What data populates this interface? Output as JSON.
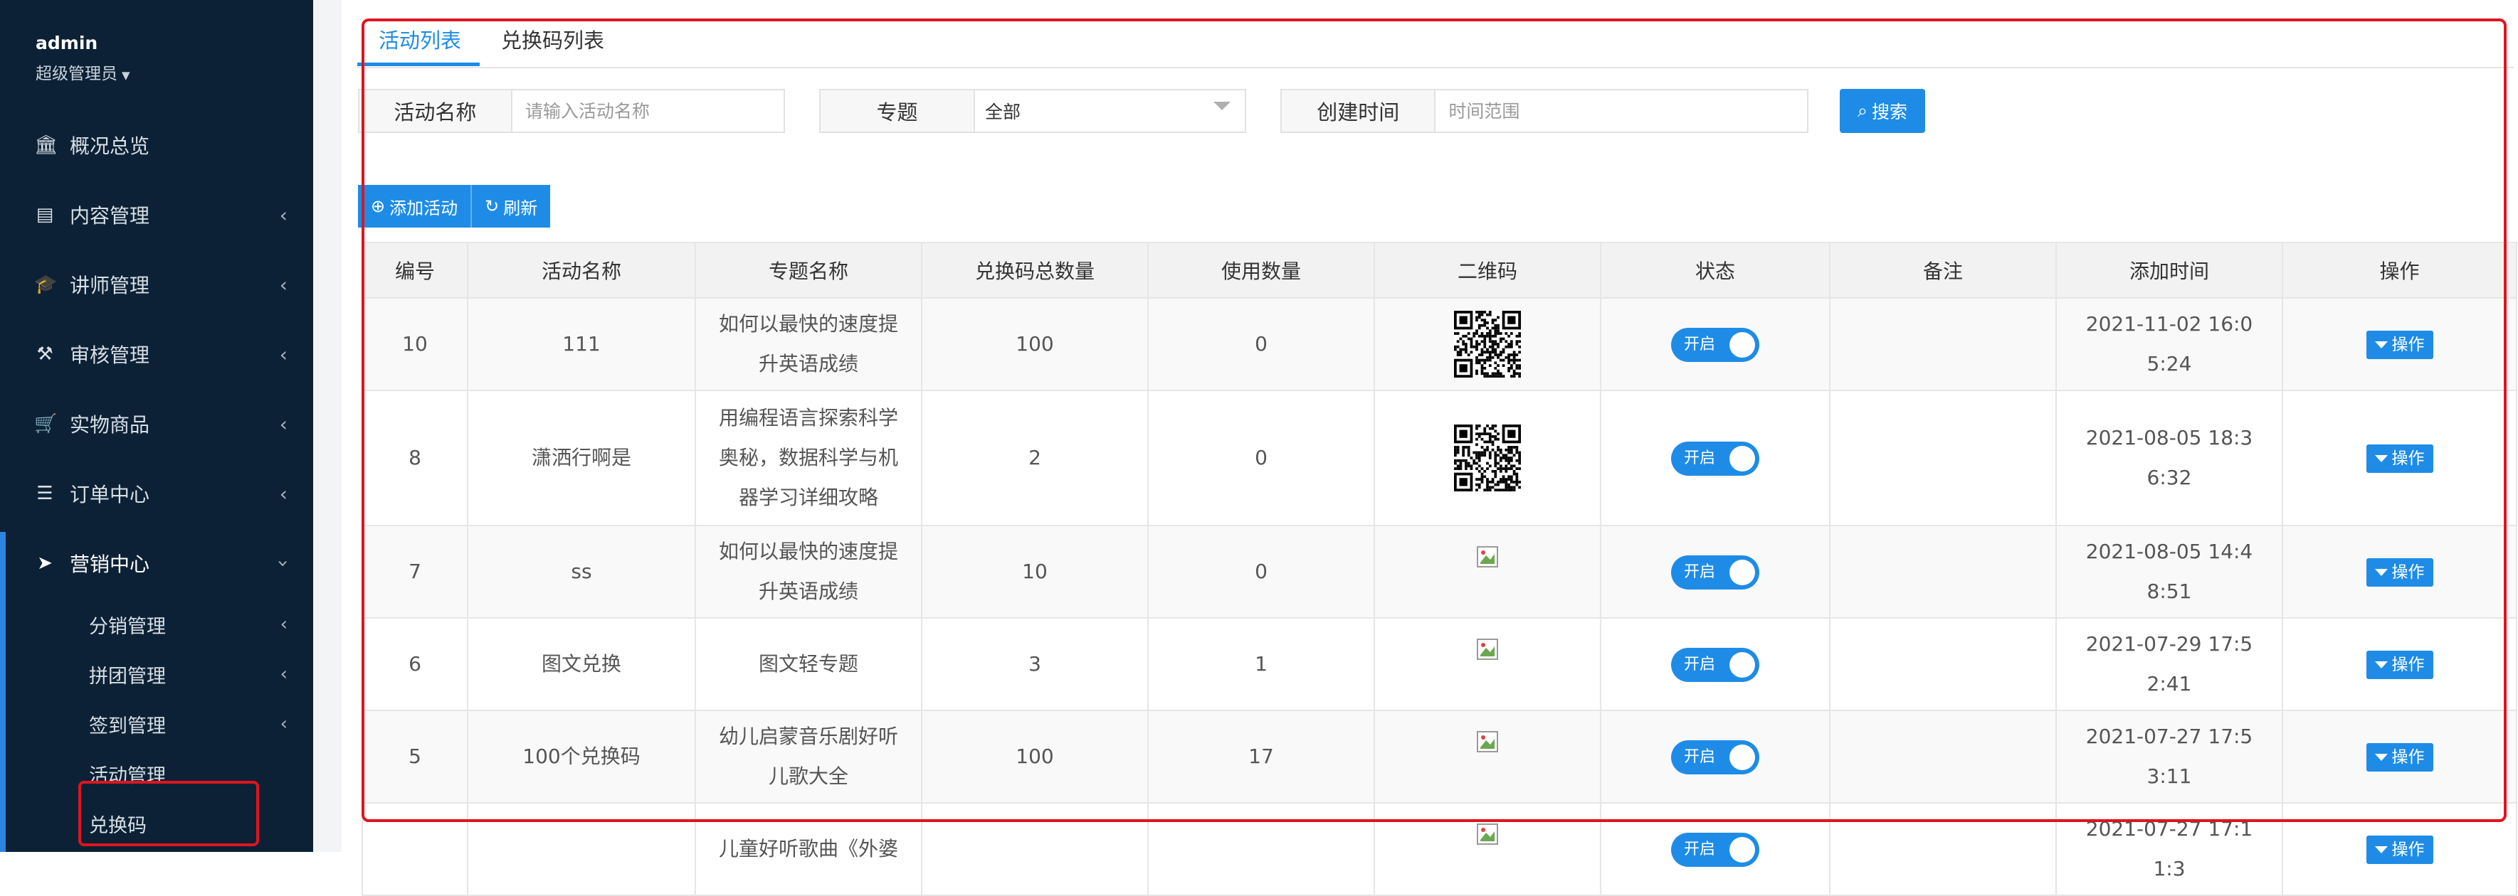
{
  "sidebar": {
    "user_name": "admin",
    "user_role": "超级管理员",
    "menu": [
      {
        "label": "概况总览",
        "icon": "bank-icon"
      },
      {
        "label": "内容管理",
        "icon": "newspaper-icon"
      },
      {
        "label": "讲师管理",
        "icon": "graduation-cap-icon"
      },
      {
        "label": "审核管理",
        "icon": "gavel-icon"
      },
      {
        "label": "实物商品",
        "icon": "cart-icon"
      },
      {
        "label": "订单中心",
        "icon": "list-icon"
      },
      {
        "label": "营销中心",
        "icon": "paper-plane-icon"
      }
    ],
    "submenu": [
      {
        "label": "分销管理"
      },
      {
        "label": "拼团管理"
      },
      {
        "label": "签到管理"
      },
      {
        "label": "活动管理"
      },
      {
        "label": "兑换码"
      }
    ]
  },
  "tabs": [
    "活动列表",
    "兑换码列表"
  ],
  "filters": {
    "name_label": "活动名称",
    "name_placeholder": "请输入活动名称",
    "topic_label": "专题",
    "topic_value": "全部",
    "time_label": "创建时间",
    "time_placeholder": "时间范围",
    "search_button": "搜索"
  },
  "toolbar": {
    "add_label": "添加活动",
    "refresh_label": "刷新"
  },
  "table": {
    "headers": [
      "编号",
      "活动名称",
      "专题名称",
      "兑换码总数量",
      "使用数量",
      "二维码",
      "状态",
      "备注",
      "添加时间",
      "操作"
    ],
    "status_label": "开启",
    "action_label": "操作",
    "rows": [
      {
        "id": "10",
        "name": "111",
        "topic": "如何以最快的速度提升英语成绩",
        "total": "100",
        "used": "0",
        "qr": "qr-code",
        "remark": "",
        "time": "2021-11-02 16:05:24"
      },
      {
        "id": "8",
        "name": "潇洒行啊是",
        "topic": "用编程语言探索科学奥秘，数据科学与机器学习详细攻略",
        "total": "2",
        "used": "0",
        "qr": "qr-code",
        "remark": "",
        "time": "2021-08-05 18:36:32"
      },
      {
        "id": "7",
        "name": "ss",
        "topic": "如何以最快的速度提升英语成绩",
        "total": "10",
        "used": "0",
        "qr": "broken-image",
        "remark": "",
        "time": "2021-08-05 14:48:51"
      },
      {
        "id": "6",
        "name": "图文兑换",
        "topic": "图文轻专题",
        "total": "3",
        "used": "1",
        "qr": "broken-image",
        "remark": "",
        "time": "2021-07-29 17:52:41"
      },
      {
        "id": "5",
        "name": "100个兑换码",
        "topic": "幼儿启蒙音乐剧好听儿歌大全",
        "total": "100",
        "used": "17",
        "qr": "broken-image",
        "remark": "",
        "time": "2021-07-27 17:53:11"
      },
      {
        "id": "",
        "name": "",
        "topic": "儿童好听歌曲《外婆",
        "total": "",
        "used": "",
        "qr": "broken-image",
        "remark": "",
        "time": "2021-07-27 17:11:3"
      }
    ]
  },
  "colors": {
    "sidebar_bg": "#0c2135",
    "accent": "#1e8ce6",
    "highlight": "#e0141f"
  }
}
